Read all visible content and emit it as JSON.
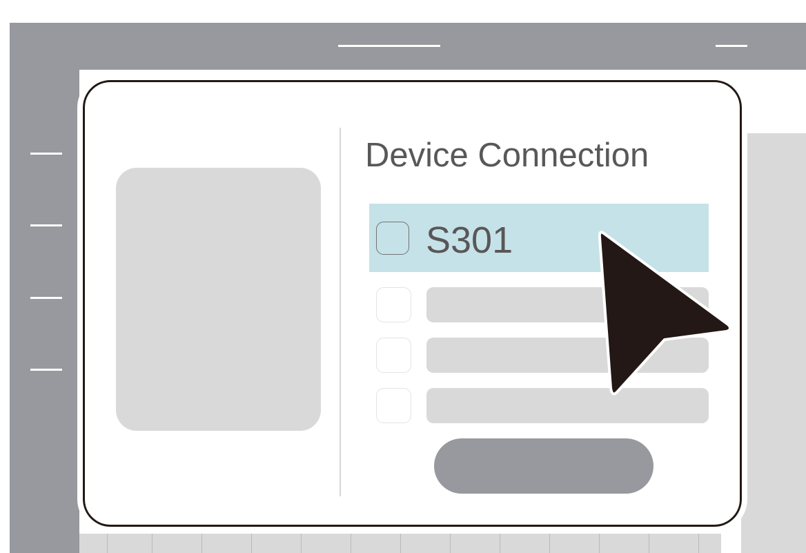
{
  "dialog": {
    "title": "Device Connection",
    "devices": [
      {
        "name": "S301",
        "selected": true
      }
    ]
  },
  "colors": {
    "chrome_gray": "#98999e",
    "placeholder_gray": "#d9d9d9",
    "selected_row": "#c5e2e8",
    "text": "#595757",
    "outline": "#231815"
  },
  "icons": {
    "pointer": "mouse-pointer-icon"
  }
}
